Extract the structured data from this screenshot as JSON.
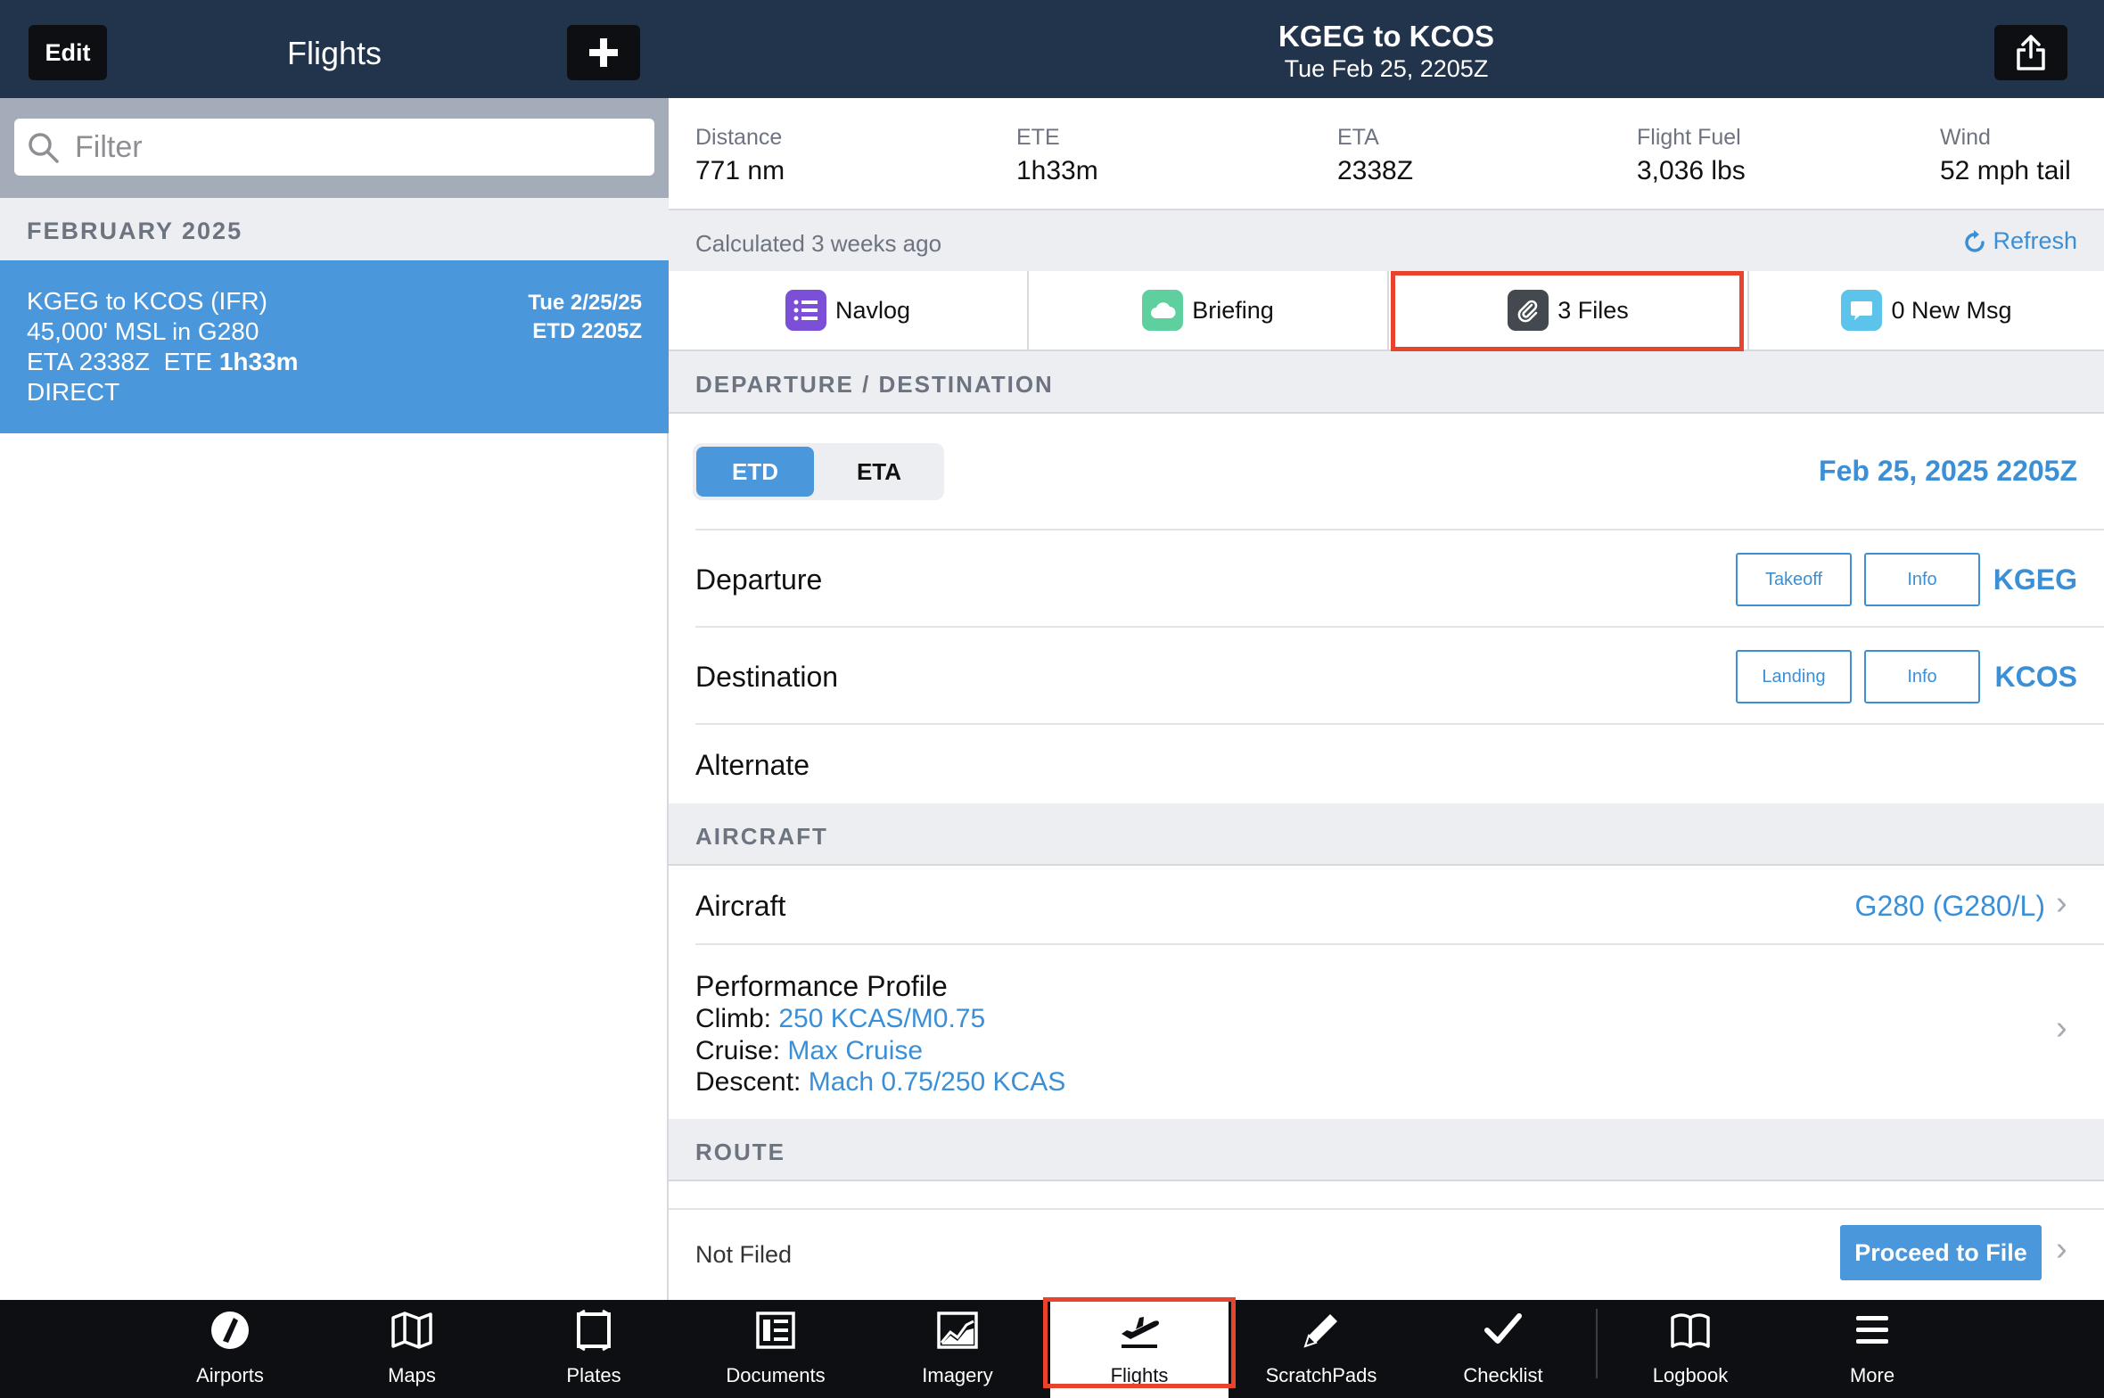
{
  "left": {
    "edit_label": "Edit",
    "title": "Flights",
    "filter_placeholder": "Filter",
    "month": "FEBRUARY 2025",
    "flight": {
      "from": "KGEG",
      "to_word": "to",
      "to": "KCOS",
      "rules": "(IFR)",
      "altitude": "45,000' MSL",
      "in_word": "in",
      "aircraft": "G280",
      "eta_label": "ETA",
      "eta": "2338Z",
      "ete_label": "ETE",
      "ete": "1h33m",
      "route": "DIRECT",
      "date": "Tue 2/25/25",
      "etd": "ETD 2205Z"
    }
  },
  "right": {
    "title": "KGEG to KCOS",
    "subtitle": "Tue Feb 25, 2205Z",
    "stats": [
      {
        "label": "Distance",
        "value": "771 nm"
      },
      {
        "label": "ETE",
        "value": "1h33m"
      },
      {
        "label": "ETA",
        "value": "2338Z"
      },
      {
        "label": "Flight Fuel",
        "value": "3,036 lbs"
      },
      {
        "label": "Wind",
        "value": "52 mph tail"
      }
    ],
    "calculated": "Calculated 3 weeks ago",
    "refresh": "Refresh",
    "tabs": [
      "Navlog",
      "Briefing",
      "3 Files",
      "0 New Msg"
    ],
    "sections": {
      "dep_dest": "DEPARTURE / DESTINATION",
      "aircraft": "AIRCRAFT",
      "route": "ROUTE"
    },
    "segment": {
      "etd": "ETD",
      "eta": "ETA"
    },
    "etd_time": "Feb 25, 2025 2205Z",
    "departure": {
      "label": "Departure",
      "btn1": "Takeoff",
      "btn2": "Info",
      "code": "KGEG"
    },
    "destination": {
      "label": "Destination",
      "btn1": "Landing",
      "btn2": "Info",
      "code": "KCOS"
    },
    "alternate": {
      "label": "Alternate"
    },
    "aircraft": {
      "label": "Aircraft",
      "value": "G280 (G280/L)"
    },
    "performance": {
      "title": "Performance Profile",
      "climb_label": "Climb:",
      "climb": "250 KCAS/M0.75",
      "cruise_label": "Cruise:",
      "cruise": "Max Cruise",
      "descent_label": "Descent:",
      "descent": "Mach 0.75/250 KCAS"
    },
    "filing": {
      "status": "Not Filed",
      "button": "Proceed to File"
    }
  },
  "tabbar": [
    "Airports",
    "Maps",
    "Plates",
    "Documents",
    "Imagery",
    "Flights",
    "ScratchPads",
    "Checklist",
    "Logbook",
    "More"
  ],
  "colors": {
    "header": "#22344c",
    "accent": "#3b8fd6",
    "selected": "#4a97dc",
    "highlight": "#e8432c",
    "tabbar": "#0d0f12"
  }
}
